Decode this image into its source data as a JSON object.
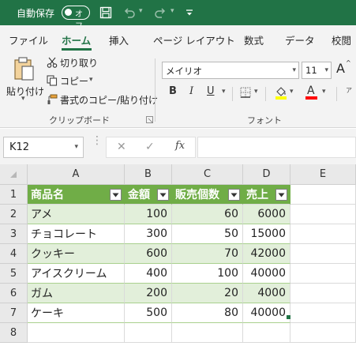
{
  "titlebar": {
    "autosave_label": "自動保存",
    "autosave_state": "オフ",
    "icons": [
      "save-icon",
      "undo-icon",
      "redo-icon",
      "customize-icon"
    ]
  },
  "ribbon_tabs": [
    "ファイル",
    "ホーム",
    "挿入",
    "ページ レイアウト",
    "数式",
    "データ",
    "校閲"
  ],
  "active_tab": "ホーム",
  "clipboard": {
    "paste_label": "貼り付け",
    "cut_label": "切り取り",
    "copy_label": "コピー",
    "format_painter_label": "書式のコピー/貼り付け",
    "group_label": "クリップボード"
  },
  "font": {
    "font_name": "メイリオ",
    "font_size": "11",
    "group_label": "フォント",
    "bold": "B",
    "italic": "I",
    "underline": "U",
    "font_color_letter": "A",
    "grow_letter": "A",
    "fill_color": "#ffff00",
    "font_color": "#ff0000"
  },
  "formula_bar": {
    "name_box": "K12",
    "fx_label": "fx",
    "formula": ""
  },
  "grid": {
    "columns": [
      "A",
      "B",
      "C",
      "D",
      "E"
    ],
    "rows": [
      "1",
      "2",
      "3",
      "4",
      "5",
      "6",
      "7",
      "8"
    ],
    "table_headers": [
      "商品名",
      "金額",
      "販売個数",
      "売上"
    ],
    "table_rows": [
      [
        "アメ",
        "100",
        "60",
        "6000"
      ],
      [
        "チョコレート",
        "300",
        "50",
        "15000"
      ],
      [
        "クッキー",
        "600",
        "70",
        "42000"
      ],
      [
        "アイスクリーム",
        "400",
        "100",
        "40000"
      ],
      [
        "ガム",
        "200",
        "20",
        "4000"
      ],
      [
        "ケーキ",
        "500",
        "80",
        "40000"
      ]
    ],
    "header_color": "#70ad47",
    "band_color": "#e2efda"
  }
}
